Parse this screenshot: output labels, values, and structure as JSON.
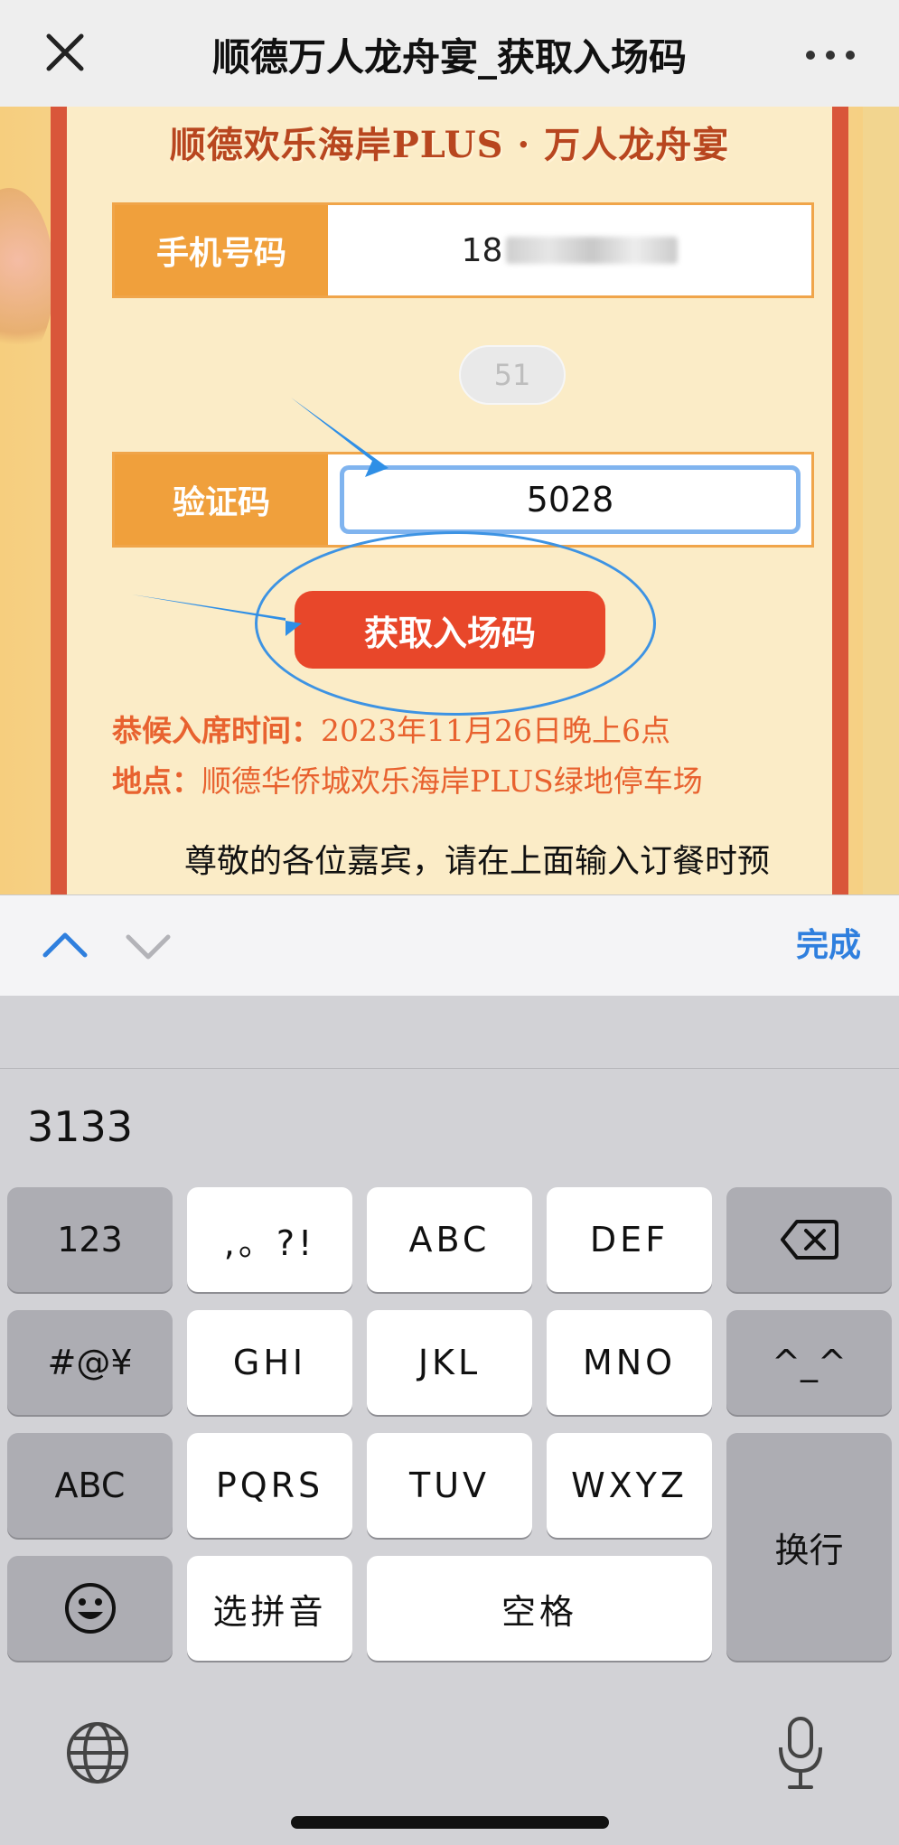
{
  "navbar": {
    "title": "顺德万人龙舟宴_获取入场码"
  },
  "page": {
    "banner": "顺德欢乐海岸PLUS · 万人龙舟宴",
    "phone_label": "手机号码",
    "phone_value": "18",
    "countdown": "51",
    "code_label": "验证码",
    "code_value": "5028",
    "get_ticket_button": "获取入场码",
    "time_key": "恭候入席时间：",
    "time_value": "2023年11月26日晚上6点",
    "place_key": "地点：",
    "place_value": "顺德华侨城欢乐海岸PLUS绿地停车场",
    "description": "尊敬的各位嘉宾，请在上面输入订餐时预"
  },
  "accessory": {
    "done_label": "完成"
  },
  "keyboard": {
    "candidate": "3133",
    "keys": {
      "num": "123",
      "punct": ",。?!",
      "abc": "ABC",
      "def": "DEF",
      "symbols": "#@¥",
      "ghi": "GHI",
      "jkl": "JKL",
      "mno": "MNO",
      "caret": "^_^",
      "abc_switch": "ABC",
      "pqrs": "PQRS",
      "tuv": "TUV",
      "wxyz": "WXYZ",
      "return": "换行",
      "pinyin": "选拼音",
      "space": "空格"
    }
  },
  "icons": {
    "close": "close-icon",
    "more": "more-icon",
    "up": "chevron-up-icon",
    "down": "chevron-down-icon",
    "delete": "delete-icon",
    "emoji": "emoji-icon",
    "globe": "globe-icon",
    "mic": "microphone-icon"
  },
  "colors": {
    "accent_orange": "#f0a03c",
    "button_red": "#e8472a",
    "highlight_blue": "#3d93e3",
    "done_blue": "#2f7fde"
  }
}
